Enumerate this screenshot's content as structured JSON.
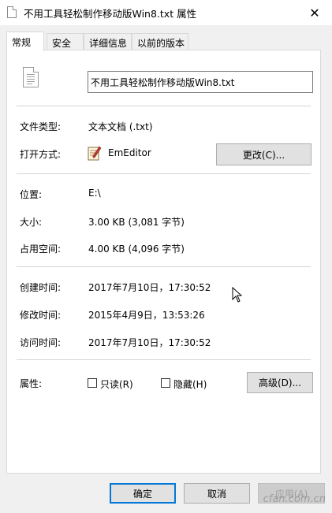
{
  "window": {
    "title": "不用工具轻松制作移动版Win8.txt 属性",
    "close_glyph": "✕"
  },
  "tabs": [
    {
      "label": "常规",
      "active": true
    },
    {
      "label": "安全",
      "active": false
    },
    {
      "label": "详细信息",
      "active": false
    },
    {
      "label": "以前的版本",
      "active": false
    }
  ],
  "general": {
    "file_name": "不用工具轻松制作移动版Win8.txt",
    "file_type_label": "文件类型:",
    "file_type_value": "文本文档 (.txt)",
    "open_with_label": "打开方式:",
    "open_with_value": "EmEditor",
    "change_button": "更改(C)...",
    "location_label": "位置:",
    "location_value": "E:\\",
    "size_label": "大小:",
    "size_value": "3.00 KB (3,081 字节)",
    "size_on_disk_label": "占用空间:",
    "size_on_disk_value": "4.00 KB (4,096 字节)",
    "created_label": "创建时间:",
    "created_value": "2017年7月10日，17:30:52",
    "modified_label": "修改时间:",
    "modified_value": "2015年4月9日，13:53:26",
    "accessed_label": "访问时间:",
    "accessed_value": "2017年7月10日，17:30:52",
    "attributes_label": "属性:",
    "readonly_label": "只读(R)",
    "readonly_checked": false,
    "hidden_label": "隐藏(H)",
    "hidden_checked": false,
    "advanced_button": "高级(D)..."
  },
  "footer": {
    "ok": "确定",
    "cancel": "取消",
    "apply": "应用(A)"
  },
  "watermark": "cfan.com.cn",
  "colors": {
    "accent": "#0078d7",
    "panel_bg": "#ffffff",
    "dialog_bg": "#f0f0f0"
  }
}
